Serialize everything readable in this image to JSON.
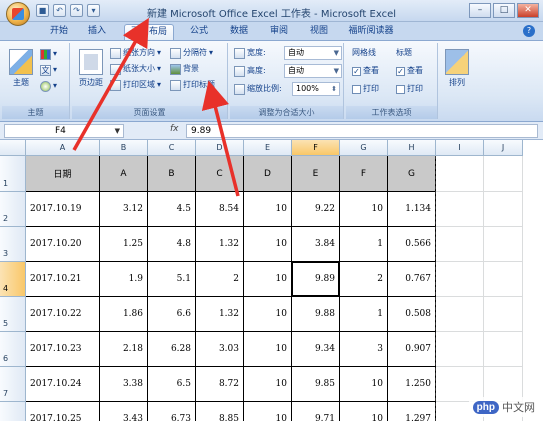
{
  "window": {
    "title": "新建 Microsoft Office Excel 工作表 - Microsoft Excel",
    "controls": [
      "–",
      "□",
      "✕"
    ]
  },
  "tabs": [
    {
      "label": "开始"
    },
    {
      "label": "插入"
    },
    {
      "label": "页面布局",
      "active": true
    },
    {
      "label": "公式"
    },
    {
      "label": "数据"
    },
    {
      "label": "审阅"
    },
    {
      "label": "视图"
    },
    {
      "label": "福昕阅读器"
    }
  ],
  "help_glyph": "?",
  "ribbon": {
    "themes": {
      "label": "主题",
      "big": "主题",
      "text_icon": "文"
    },
    "page_setup": {
      "label": "页面设置",
      "margins": "页边距",
      "orientation": "纸张方向",
      "size": "纸张大小",
      "print_area": "打印区域",
      "breaks": "分隔符",
      "background": "背景",
      "print_titles": "打印标题"
    },
    "scale_to_fit": {
      "label": "调整为合适大小",
      "width_label": "宽度:",
      "width_value": "自动",
      "height_label": "高度:",
      "height_value": "自动",
      "scale_label": "缩放比例:",
      "scale_value": "100%"
    },
    "sheet_options": {
      "label": "工作表选项",
      "gridlines": "网格线",
      "headings": "标题",
      "view": "查看",
      "print": "打印",
      "check": "✓"
    },
    "arrange": {
      "label": "排列"
    }
  },
  "formula_bar": {
    "name_box": "F4",
    "fx": "fx",
    "formula": "9.89"
  },
  "columns": [
    "A",
    "B",
    "C",
    "D",
    "E",
    "F",
    "G",
    "H",
    "I",
    "J"
  ],
  "row_numbers": [
    "1",
    "2",
    "3",
    "4",
    "5",
    "6",
    "7",
    "8"
  ],
  "header_row": [
    "日期",
    "A",
    "B",
    "C",
    "D",
    "E",
    "F",
    "G"
  ],
  "rows": [
    [
      "2017.10.19",
      "3.12",
      "4.5",
      "8.54",
      "10",
      "9.22",
      "10",
      "1.134"
    ],
    [
      "2017.10.20",
      "1.25",
      "4.8",
      "1.32",
      "10",
      "3.84",
      "1",
      "0.566"
    ],
    [
      "2017.10.21",
      "1.9",
      "5.1",
      "2",
      "10",
      "9.89",
      "2",
      "0.767"
    ],
    [
      "2017.10.22",
      "1.86",
      "6.6",
      "1.32",
      "10",
      "9.88",
      "1",
      "0.508"
    ],
    [
      "2017.10.23",
      "2.18",
      "6.28",
      "3.03",
      "10",
      "9.34",
      "3",
      "0.907"
    ],
    [
      "2017.10.24",
      "3.38",
      "6.5",
      "8.72",
      "10",
      "9.85",
      "10",
      "1.250"
    ],
    [
      "2017.10.25",
      "3.43",
      "6.73",
      "8.85",
      "10",
      "9.71",
      "10",
      "1.297"
    ]
  ],
  "watermark": {
    "badge": "php",
    "text": "中文网"
  },
  "colors": {
    "accent": "#e8312a",
    "header_fill": "#c9c9c9",
    "selection": "#f9c768"
  }
}
